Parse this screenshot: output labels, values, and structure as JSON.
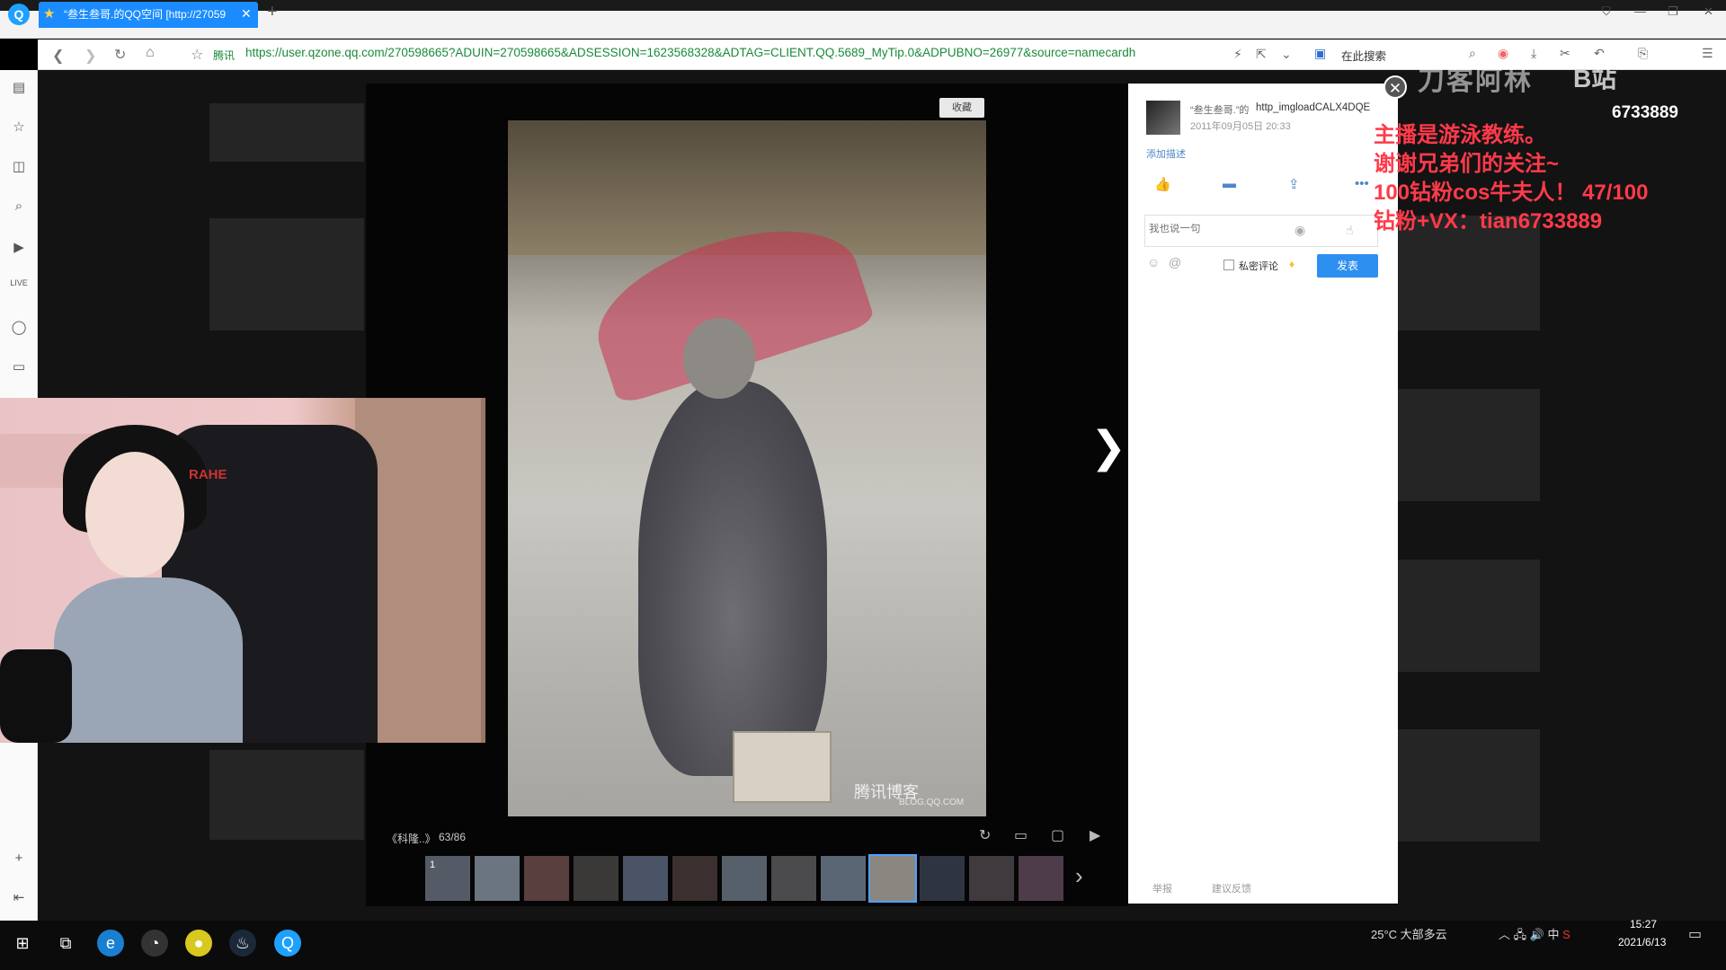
{
  "browser": {
    "tab_title": "“叁生叁哥.的QQ空间 [http://27059",
    "url": "https://user.qzone.qq.com/270598665?ADUIN=270598665&ADSESSION=1623568328&ADTAG=CLIENT.QQ.5689_MyTip.0&ADPUBNO=26977&source=namecardh",
    "url_label": "腾讯",
    "search_hint": "在此搜索"
  },
  "viewer": {
    "collect_label": "收藏",
    "album_title": "《科隆..》",
    "counter": "63/86",
    "watermark": "腾讯博客",
    "watermark_sub": "BLOG.QQ.COM",
    "first_thumb_index": "1"
  },
  "panel": {
    "author": "“叁生叁哥.”的",
    "photo_name": "http_imgloadCALX4DQE",
    "date": "2011年09月05日 20:33",
    "add_description": "添加描述",
    "comment_placeholder": "我也说一句",
    "private_comment_label": "私密评论",
    "publish_label": "发表",
    "report_label": "举报",
    "feedback_label": "建议反馈"
  },
  "overlay": {
    "streamer_name": "刀客阿林",
    "room_id": "6733889",
    "lines": [
      "主播是游泳教练。",
      "谢谢兄弟们的关注~",
      "100钻粉cos牛夫人！ 47/100",
      "钻粉+VX：tian6733889"
    ]
  },
  "webcam": {
    "chair_brand": "RAHE"
  },
  "taskbar": {
    "weather": "25°C 大部多云",
    "ime": "中",
    "time": "15:27",
    "date": "2021/6/13"
  },
  "colors": {
    "accent": "#1a8cff",
    "publish_button": "#2d8ff0",
    "overlay_text": "#ff3a4a",
    "url_green": "#1a8a3a"
  }
}
